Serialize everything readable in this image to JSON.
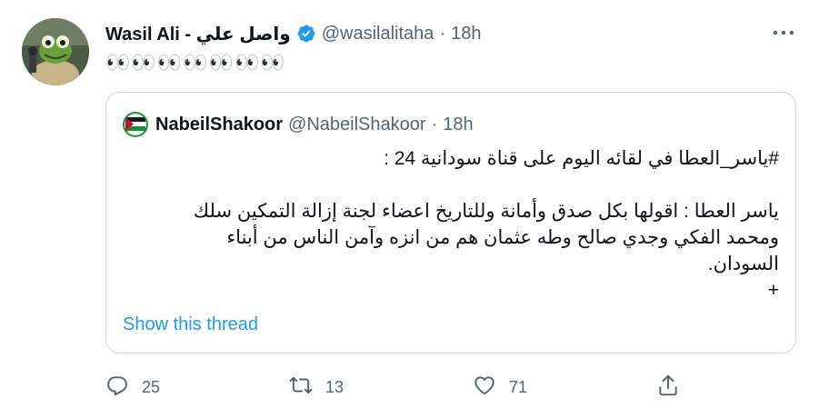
{
  "tweet": {
    "display_name": "Wasil Ali - واصل علي",
    "handle": "@wasilalitaha",
    "separator": "·",
    "time": "18h",
    "text": "👀👀👀👀👀👀👀",
    "avatar_icon": "kermit-frog-avatar",
    "verified_icon": "verified-badge-icon",
    "more_icon": "more-options-icon"
  },
  "quote": {
    "avatar_icon": "party-logo-avatar",
    "display_name": "NabeilShakoor",
    "handle": "@NabeilShakoor",
    "separator": "·",
    "time": "18h",
    "lines": [
      "#ياسر_العطا في لقائه اليوم على قناة سودانية 24 :",
      "",
      "ياسر العطا : اقولها بكل صدق وأمانة وللتاريخ اعضاء لجنة إزالة التمكين  سلك",
      "ومحمد الفكي وجدي صالح وطه عثمان هم من انزه وآمن الناس من أبناء",
      "السودان.",
      "+"
    ],
    "show_thread": "Show this thread"
  },
  "actions": {
    "reply": {
      "icon": "reply-icon",
      "count": "25"
    },
    "retweet": {
      "icon": "retweet-icon",
      "count": "13"
    },
    "like": {
      "icon": "heart-icon",
      "count": "71"
    },
    "share": {
      "icon": "share-icon"
    }
  },
  "colors": {
    "link": "#1d9bf0",
    "secondary_text": "#536471",
    "border": "#cfd9de",
    "verified": "#1d9bf0"
  }
}
